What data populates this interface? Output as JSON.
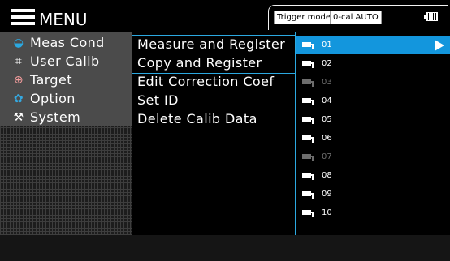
{
  "header": {
    "menu_title": "MENU",
    "trigger_mode": "Trigger mode",
    "calibration": "0-cal AUTO"
  },
  "sidebar": {
    "items": [
      {
        "label": "Meas Cond",
        "icon": "meas-cond-icon",
        "color": "#2ba8e0"
      },
      {
        "label": "User Calib",
        "icon": "user-calib-icon",
        "color": "#ffffff"
      },
      {
        "label": "Target",
        "icon": "target-icon",
        "color": "#f29c9c"
      },
      {
        "label": "Option",
        "icon": "gear-icon",
        "color": "#35a9e1"
      },
      {
        "label": "System",
        "icon": "tools-icon",
        "color": "#ffffff"
      }
    ]
  },
  "submenu": {
    "items": [
      {
        "label": "Measure and Register"
      },
      {
        "label": "Copy and Register"
      },
      {
        "label": "Edit Correction Coef"
      },
      {
        "label": "Set ID"
      },
      {
        "label": "Delete Calib Data"
      }
    ]
  },
  "ids": {
    "items": [
      {
        "label": "01",
        "state": "selected"
      },
      {
        "label": "02",
        "state": "normal"
      },
      {
        "label": "03",
        "state": "dim"
      },
      {
        "label": "04",
        "state": "normal"
      },
      {
        "label": "05",
        "state": "normal"
      },
      {
        "label": "06",
        "state": "normal"
      },
      {
        "label": "07",
        "state": "dim"
      },
      {
        "label": "08",
        "state": "normal"
      },
      {
        "label": "09",
        "state": "normal"
      },
      {
        "label": "10",
        "state": "normal"
      }
    ]
  },
  "colors": {
    "accent": "#2ba8e0",
    "selected": "#1396dd",
    "dim": "#6d6d6d"
  }
}
